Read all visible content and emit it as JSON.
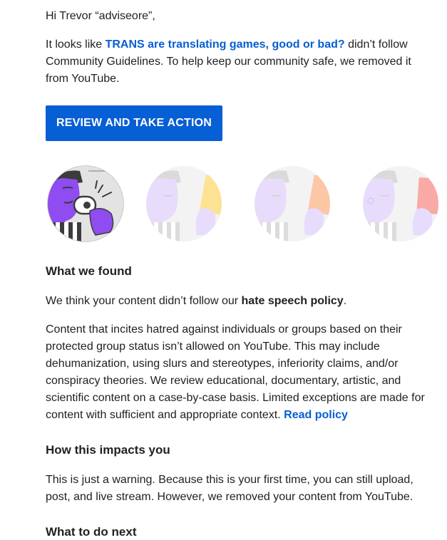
{
  "greeting": "Hi Trevor “adviseore”,",
  "intro": {
    "before": "It looks like ",
    "video_title": "TRANS are translating games, good or bad?",
    "after": " didn’t follow Community Guidelines. To help keep our community safe, we removed it from YouTube."
  },
  "cta_label": "REVIEW AND TAKE ACTION",
  "strike_illustrations": [
    {
      "icon": "referee-whistle-icon",
      "state": "active"
    },
    {
      "icon": "yellow-card-icon",
      "state": "faded"
    },
    {
      "icon": "orange-card-icon",
      "state": "faded"
    },
    {
      "icon": "red-card-icon",
      "state": "faded"
    }
  ],
  "colors": {
    "link": "#065fd4",
    "button": "#065fd4",
    "purple": "#8f4cf0",
    "yellow_card": "#fde293",
    "orange_card": "#fbc7a4",
    "red_card": "#f9a9a6"
  },
  "sections": {
    "found": {
      "heading": "What we found",
      "summary_before": "We think your content didn’t follow our ",
      "summary_policy": "hate speech policy",
      "summary_after": ".",
      "details": "Content that incites hatred against individuals or groups based on their protected group status isn’t allowed on YouTube. This may include dehumanization, using slurs and stereotypes, inferiority claims, and/or conspiracy theories. We review educational, documentary, artistic, and scientific content on a case-by-case basis. Limited exceptions are made for content with sufficient and appropriate context. ",
      "read_policy": "Read policy"
    },
    "impact": {
      "heading": "How this impacts you",
      "text": "This is just a warning. Because this is your first time, you can still upload, post, and live stream. However, we removed your content from YouTube."
    },
    "next": {
      "heading": "What to do next"
    }
  }
}
